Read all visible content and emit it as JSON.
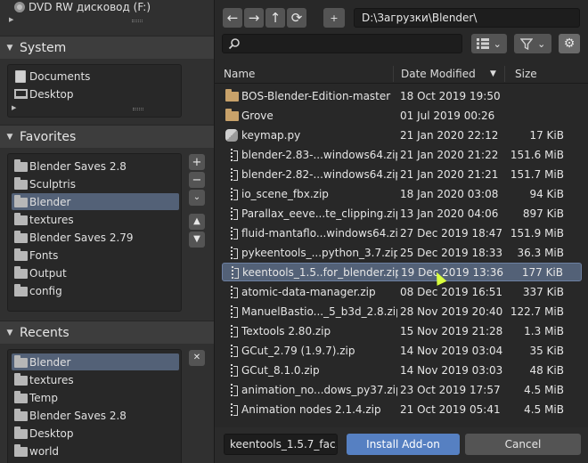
{
  "sidebar": {
    "top_items": [
      {
        "label": "DVD RW дисковод (F:)",
        "icon": "disk-icon"
      }
    ],
    "system": {
      "title": "System",
      "items": [
        {
          "label": "Documents",
          "icon": "document-icon"
        },
        {
          "label": "Desktop",
          "icon": "desktop-icon"
        }
      ]
    },
    "favorites": {
      "title": "Favorites",
      "items": [
        {
          "label": "Blender Saves 2.8"
        },
        {
          "label": "Sculptris"
        },
        {
          "label": "Blender"
        },
        {
          "label": "textures"
        },
        {
          "label": "Blender Saves 2.79"
        },
        {
          "label": "Fonts"
        },
        {
          "label": "Output"
        },
        {
          "label": "config"
        }
      ],
      "selected_index": 2,
      "buttons": {
        "add": "+",
        "remove": "−",
        "menu": "⌄",
        "up": "▲",
        "down": "▼"
      }
    },
    "recents": {
      "title": "Recents",
      "items": [
        {
          "label": "Blender"
        },
        {
          "label": "textures"
        },
        {
          "label": "Temp"
        },
        {
          "label": "Blender Saves 2.8"
        },
        {
          "label": "Desktop"
        },
        {
          "label": "world"
        }
      ],
      "selected_index": 0,
      "clear_button": "✕"
    }
  },
  "toolbar": {
    "back": "←",
    "forward": "→",
    "parent": "↑",
    "refresh": "⟳",
    "new_folder": "+",
    "path": "D:\\Загрузки\\Blender\\"
  },
  "search": {
    "value": "",
    "placeholder": ""
  },
  "columns": {
    "name": "Name",
    "date": "Date Modified",
    "size": "Size",
    "sort_indicator": "▼"
  },
  "files": [
    {
      "name": "BOS-Blender-Edition-master",
      "date": "18 Oct 2019 19:50",
      "size": "",
      "type": "folder"
    },
    {
      "name": "Grove",
      "date": "01 Jul 2019 00:26",
      "size": "",
      "type": "folder"
    },
    {
      "name": "keymap.py",
      "date": "21 Jan 2020 22:12",
      "size": "17 KiB",
      "type": "python"
    },
    {
      "name": "blender-2.83-...windows64.zip",
      "date": "21 Jan 2020 21:22",
      "size": "151.6 MiB",
      "type": "zip"
    },
    {
      "name": "blender-2.82-...windows64.zip",
      "date": "21 Jan 2020 21:21",
      "size": "151.7 MiB",
      "type": "zip"
    },
    {
      "name": "io_scene_fbx.zip",
      "date": "18 Jan 2020 03:08",
      "size": "94 KiB",
      "type": "zip"
    },
    {
      "name": "Parallax_eeve...te_clipping.zip",
      "date": "13 Jan 2020 04:06",
      "size": "897 KiB",
      "type": "zip"
    },
    {
      "name": "fluid-mantaflo...windows64.zip",
      "date": "27 Dec 2019 18:47",
      "size": "151.9 MiB",
      "type": "zip"
    },
    {
      "name": "pykeentools_...python_3.7.zip",
      "date": "25 Dec 2019 18:33",
      "size": "36.3 MiB",
      "type": "zip"
    },
    {
      "name": "keentools_1.5..for_blender.zip",
      "date": "19 Dec 2019 13:36",
      "size": "177 KiB",
      "type": "zip"
    },
    {
      "name": "atomic-data-manager.zip",
      "date": "08 Dec 2019 16:51",
      "size": "337 KiB",
      "type": "zip"
    },
    {
      "name": "ManuelBastio..._5_b3d_2.8.zip",
      "date": "28 Nov 2019 20:40",
      "size": "122.7 MiB",
      "type": "zip"
    },
    {
      "name": "Textools 2.80.zip",
      "date": "15 Nov 2019 21:28",
      "size": "1.3 MiB",
      "type": "zip"
    },
    {
      "name": "GCut_2.79 (1.9.7).zip",
      "date": "14 Nov 2019 03:04",
      "size": "35 KiB",
      "type": "zip"
    },
    {
      "name": "GCut_8.1.0.zip",
      "date": "14 Nov 2019 03:03",
      "size": "48 KiB",
      "type": "zip"
    },
    {
      "name": "animation_no...dows_py37.zip",
      "date": "23 Oct 2019 17:57",
      "size": "4.5 MiB",
      "type": "zip"
    },
    {
      "name": "Animation nodes 2.1.4.zip",
      "date": "21 Oct 2019 05:41",
      "size": "4.5 MiB",
      "type": "zip"
    }
  ],
  "selected_file_index": 9,
  "bottom": {
    "filename": "keentools_1.5.7_fac...",
    "install_label": "Install Add-on",
    "cancel_label": "Cancel"
  },
  "colors": {
    "accent": "#5680c2",
    "selection": "#536177",
    "folder_tan": "#c8a26a"
  }
}
